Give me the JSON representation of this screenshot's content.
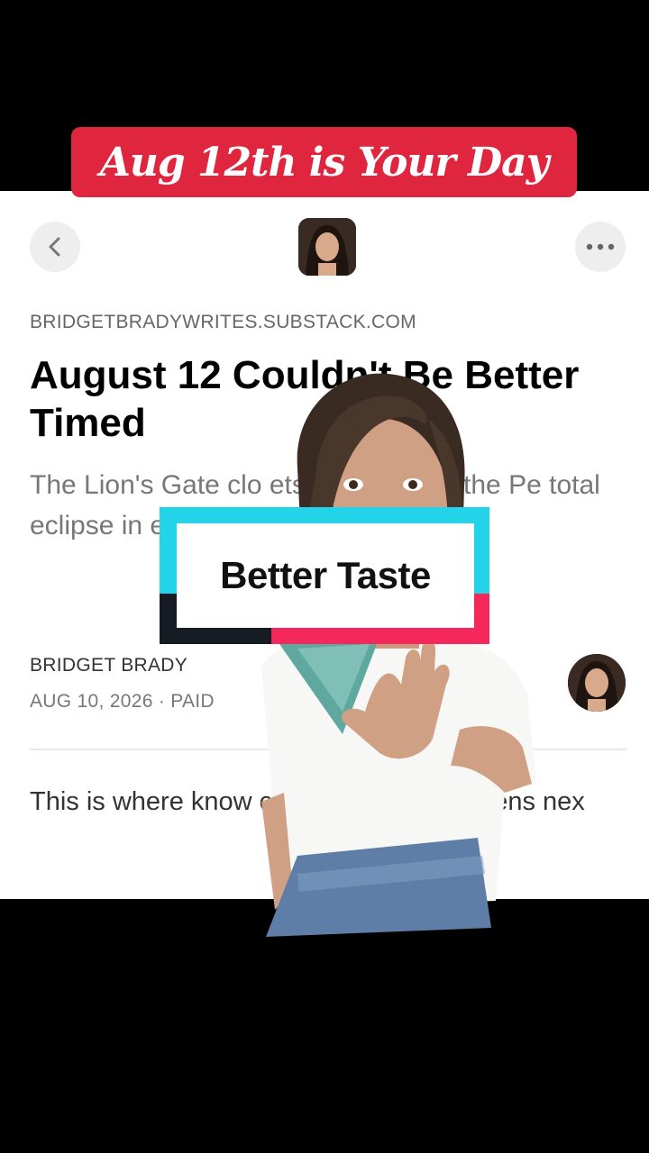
{
  "banner": {
    "text": "Aug 12th is Your Day"
  },
  "article": {
    "publication": "BRIDGETBRADYWRITES.SUBSTACK.COM",
    "title": "August 12 Couldn't Be Better Timed",
    "subtitle": "The Lion's Gate clo ets appear, and the Pe total eclipse in e everything love.",
    "author": "BRIDGET BRADY",
    "meta": "AUG 10, 2026 · PAID",
    "body": "This is where know changing what happens nex"
  },
  "sticker": {
    "text": "Better Taste"
  },
  "colors": {
    "banner": "#e0263f",
    "sticker_cyan": "#22d3ea",
    "sticker_pink": "#f5285b",
    "sticker_dark": "#161b24"
  },
  "icons": {
    "back": "chevron-left-icon",
    "more": "more-horizontal-icon"
  }
}
